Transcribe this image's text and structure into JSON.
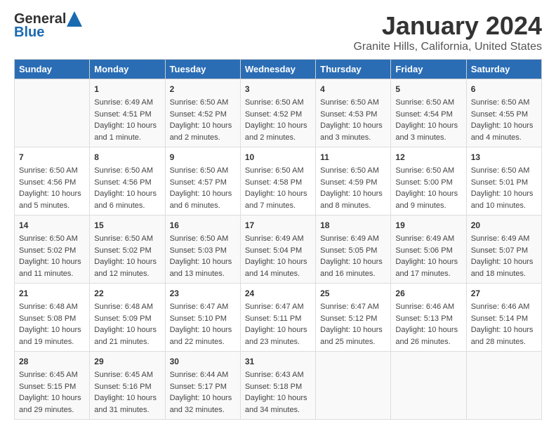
{
  "logo": {
    "general": "General",
    "blue": "Blue"
  },
  "title": {
    "month": "January 2024",
    "location": "Granite Hills, California, United States"
  },
  "calendar": {
    "headers": [
      "Sunday",
      "Monday",
      "Tuesday",
      "Wednesday",
      "Thursday",
      "Friday",
      "Saturday"
    ],
    "weeks": [
      [
        {
          "day": "",
          "details": ""
        },
        {
          "day": "1",
          "details": "Sunrise: 6:49 AM\nSunset: 4:51 PM\nDaylight: 10 hours\nand 1 minute."
        },
        {
          "day": "2",
          "details": "Sunrise: 6:50 AM\nSunset: 4:52 PM\nDaylight: 10 hours\nand 2 minutes."
        },
        {
          "day": "3",
          "details": "Sunrise: 6:50 AM\nSunset: 4:52 PM\nDaylight: 10 hours\nand 2 minutes."
        },
        {
          "day": "4",
          "details": "Sunrise: 6:50 AM\nSunset: 4:53 PM\nDaylight: 10 hours\nand 3 minutes."
        },
        {
          "day": "5",
          "details": "Sunrise: 6:50 AM\nSunset: 4:54 PM\nDaylight: 10 hours\nand 3 minutes."
        },
        {
          "day": "6",
          "details": "Sunrise: 6:50 AM\nSunset: 4:55 PM\nDaylight: 10 hours\nand 4 minutes."
        }
      ],
      [
        {
          "day": "7",
          "details": "Sunrise: 6:50 AM\nSunset: 4:56 PM\nDaylight: 10 hours\nand 5 minutes."
        },
        {
          "day": "8",
          "details": "Sunrise: 6:50 AM\nSunset: 4:56 PM\nDaylight: 10 hours\nand 6 minutes."
        },
        {
          "day": "9",
          "details": "Sunrise: 6:50 AM\nSunset: 4:57 PM\nDaylight: 10 hours\nand 6 minutes."
        },
        {
          "day": "10",
          "details": "Sunrise: 6:50 AM\nSunset: 4:58 PM\nDaylight: 10 hours\nand 7 minutes."
        },
        {
          "day": "11",
          "details": "Sunrise: 6:50 AM\nSunset: 4:59 PM\nDaylight: 10 hours\nand 8 minutes."
        },
        {
          "day": "12",
          "details": "Sunrise: 6:50 AM\nSunset: 5:00 PM\nDaylight: 10 hours\nand 9 minutes."
        },
        {
          "day": "13",
          "details": "Sunrise: 6:50 AM\nSunset: 5:01 PM\nDaylight: 10 hours\nand 10 minutes."
        }
      ],
      [
        {
          "day": "14",
          "details": "Sunrise: 6:50 AM\nSunset: 5:02 PM\nDaylight: 10 hours\nand 11 minutes."
        },
        {
          "day": "15",
          "details": "Sunrise: 6:50 AM\nSunset: 5:02 PM\nDaylight: 10 hours\nand 12 minutes."
        },
        {
          "day": "16",
          "details": "Sunrise: 6:50 AM\nSunset: 5:03 PM\nDaylight: 10 hours\nand 13 minutes."
        },
        {
          "day": "17",
          "details": "Sunrise: 6:49 AM\nSunset: 5:04 PM\nDaylight: 10 hours\nand 14 minutes."
        },
        {
          "day": "18",
          "details": "Sunrise: 6:49 AM\nSunset: 5:05 PM\nDaylight: 10 hours\nand 16 minutes."
        },
        {
          "day": "19",
          "details": "Sunrise: 6:49 AM\nSunset: 5:06 PM\nDaylight: 10 hours\nand 17 minutes."
        },
        {
          "day": "20",
          "details": "Sunrise: 6:49 AM\nSunset: 5:07 PM\nDaylight: 10 hours\nand 18 minutes."
        }
      ],
      [
        {
          "day": "21",
          "details": "Sunrise: 6:48 AM\nSunset: 5:08 PM\nDaylight: 10 hours\nand 19 minutes."
        },
        {
          "day": "22",
          "details": "Sunrise: 6:48 AM\nSunset: 5:09 PM\nDaylight: 10 hours\nand 21 minutes."
        },
        {
          "day": "23",
          "details": "Sunrise: 6:47 AM\nSunset: 5:10 PM\nDaylight: 10 hours\nand 22 minutes."
        },
        {
          "day": "24",
          "details": "Sunrise: 6:47 AM\nSunset: 5:11 PM\nDaylight: 10 hours\nand 23 minutes."
        },
        {
          "day": "25",
          "details": "Sunrise: 6:47 AM\nSunset: 5:12 PM\nDaylight: 10 hours\nand 25 minutes."
        },
        {
          "day": "26",
          "details": "Sunrise: 6:46 AM\nSunset: 5:13 PM\nDaylight: 10 hours\nand 26 minutes."
        },
        {
          "day": "27",
          "details": "Sunrise: 6:46 AM\nSunset: 5:14 PM\nDaylight: 10 hours\nand 28 minutes."
        }
      ],
      [
        {
          "day": "28",
          "details": "Sunrise: 6:45 AM\nSunset: 5:15 PM\nDaylight: 10 hours\nand 29 minutes."
        },
        {
          "day": "29",
          "details": "Sunrise: 6:45 AM\nSunset: 5:16 PM\nDaylight: 10 hours\nand 31 minutes."
        },
        {
          "day": "30",
          "details": "Sunrise: 6:44 AM\nSunset: 5:17 PM\nDaylight: 10 hours\nand 32 minutes."
        },
        {
          "day": "31",
          "details": "Sunrise: 6:43 AM\nSunset: 5:18 PM\nDaylight: 10 hours\nand 34 minutes."
        },
        {
          "day": "",
          "details": ""
        },
        {
          "day": "",
          "details": ""
        },
        {
          "day": "",
          "details": ""
        }
      ]
    ]
  }
}
